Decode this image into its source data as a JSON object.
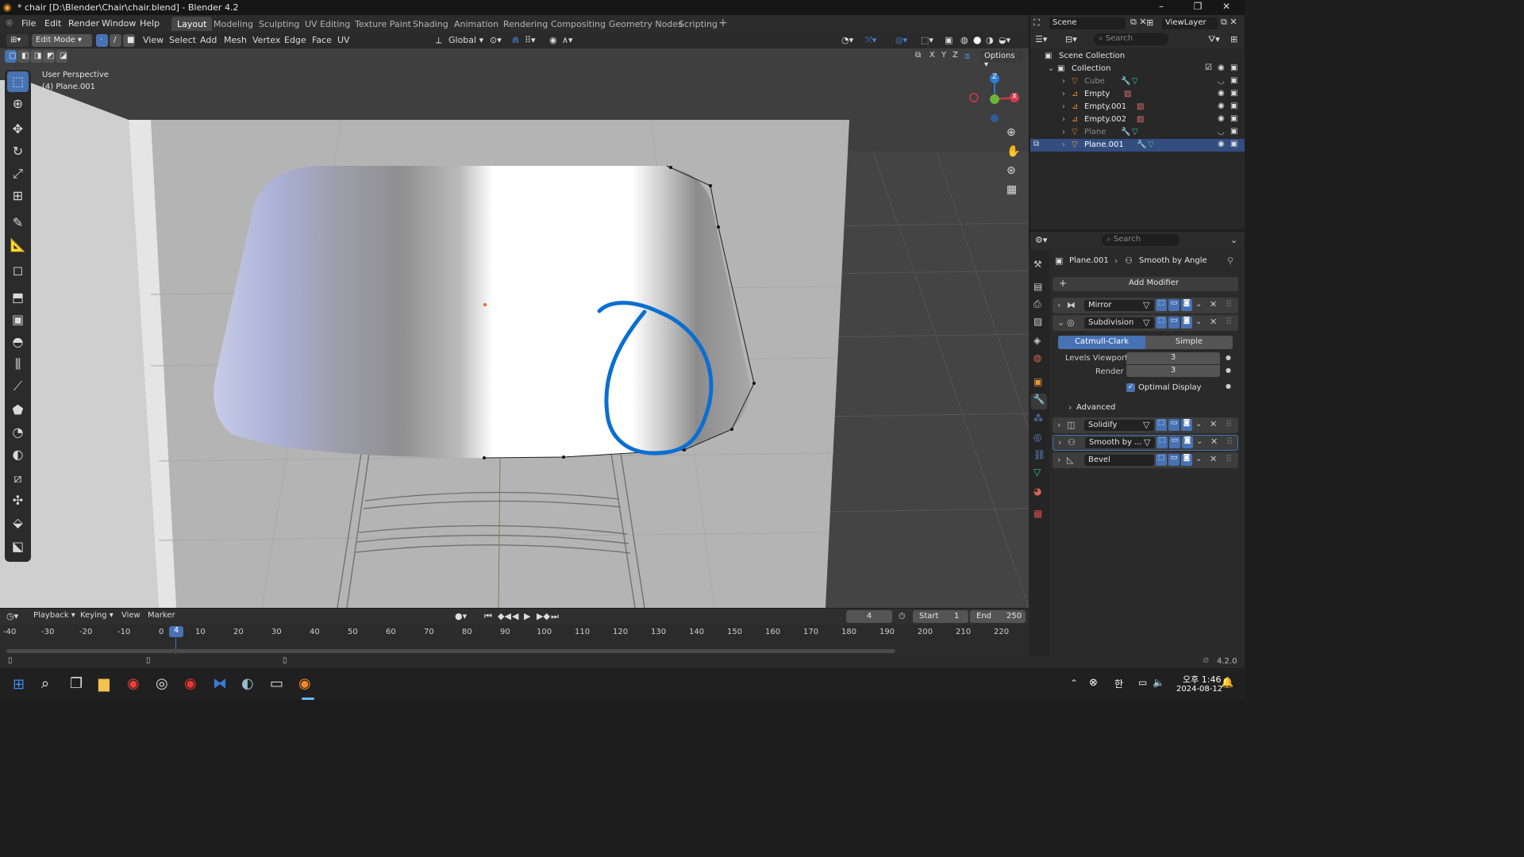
{
  "window": {
    "title": "* chair [D:\\Blender\\Chair\\chair.blend] - Blender 4.2",
    "controls": [
      "–",
      "❐",
      "✕"
    ]
  },
  "menu": [
    "File",
    "Edit",
    "Render",
    "Window",
    "Help"
  ],
  "workspaces": [
    "Layout",
    "Modeling",
    "Sculpting",
    "UV Editing",
    "Texture Paint",
    "Shading",
    "Animation",
    "Rendering",
    "Compositing",
    "Geometry Nodes",
    "Scripting"
  ],
  "active_workspace": "Layout",
  "scene": {
    "name": "Scene",
    "view_layer": "ViewLayer"
  },
  "viewport_header": {
    "mode": "Edit Mode",
    "menus": [
      "View",
      "Select",
      "Add",
      "Mesh",
      "Vertex",
      "Edge",
      "Face",
      "UV"
    ],
    "transform_orientation": "Global",
    "options_label": "Options",
    "axes": [
      "X",
      "Y",
      "Z"
    ]
  },
  "viewport": {
    "perspective": "User Perspective",
    "object_label": "(4) Plane.001"
  },
  "gizmo": {
    "x": "X",
    "y": "Y",
    "z": "Z"
  },
  "outliner": {
    "search_placeholder": "Search",
    "scene_collection": "Scene Collection",
    "collection": "Collection",
    "items": [
      {
        "name": "Cube",
        "state": "dim"
      },
      {
        "name": "Empty",
        "state": "normal"
      },
      {
        "name": "Empty.001",
        "state": "normal"
      },
      {
        "name": "Empty.002",
        "state": "normal"
      },
      {
        "name": "Plane",
        "state": "dim"
      },
      {
        "name": "Plane.001",
        "state": "selected"
      }
    ]
  },
  "properties": {
    "search_placeholder": "Search",
    "breadcrumb_object": "Plane.001",
    "breadcrumb_modifier": "Smooth by Angle",
    "add_modifier": "Add Modifier",
    "modifiers": [
      {
        "name": "Mirror",
        "expanded": false
      },
      {
        "name": "Subdivision",
        "expanded": true
      },
      {
        "name": "Solidify",
        "expanded": false
      },
      {
        "name": "Smooth by ...",
        "expanded": false
      },
      {
        "name": "Bevel",
        "expanded": false
      }
    ],
    "subdivision": {
      "type_options": [
        "Catmull-Clark",
        "Simple"
      ],
      "active_type": "Catmull-Clark",
      "levels_viewport_label": "Levels Viewport",
      "levels_viewport": "3",
      "render_label": "Render",
      "render": "3",
      "optimal_display_label": "Optimal Display",
      "advanced_label": "Advanced"
    }
  },
  "timeline": {
    "menus": [
      "Playback",
      "Keying",
      "View",
      "Marker"
    ],
    "current_frame": "4",
    "start_label": "Start",
    "start": "1",
    "end_label": "End",
    "end": "250",
    "ruler": [
      "-40",
      "-30",
      "-20",
      "-10",
      "0",
      "4",
      "10",
      "20",
      "30",
      "40",
      "50",
      "60",
      "70",
      "80",
      "90",
      "100",
      "110",
      "120",
      "130",
      "140",
      "150",
      "160",
      "170",
      "180",
      "190",
      "200",
      "210",
      "220"
    ]
  },
  "status": {
    "version": "4.2.0"
  },
  "taskbar": {
    "time": "오후 1:46",
    "date": "2024-08-12",
    "ime": "한"
  },
  "colors": {
    "accent": "#4772b3",
    "annotation_stroke": "#0a6fd1",
    "header_bg": "#2c2c2c",
    "viewport_bg": "#3f3f3f"
  }
}
